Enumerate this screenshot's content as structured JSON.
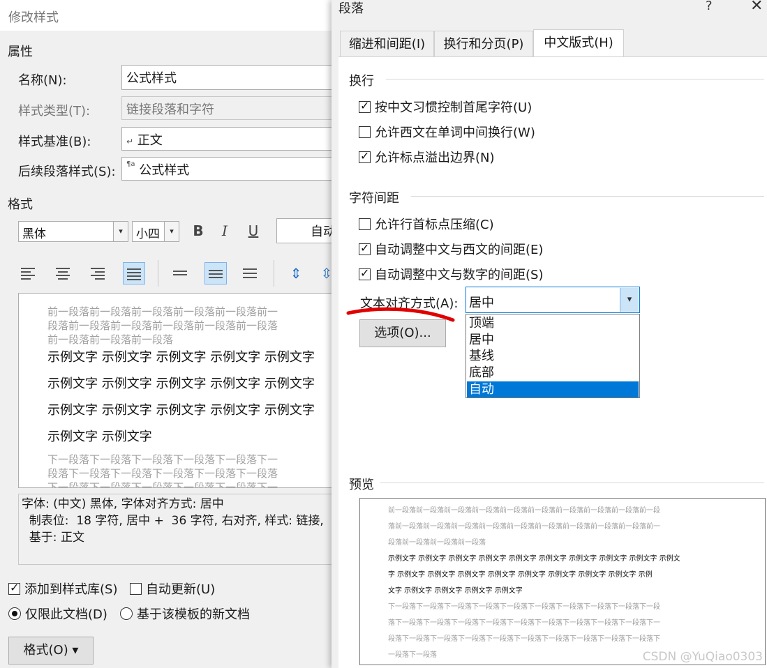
{
  "left_dialog": {
    "title": "修改样式",
    "properties_header": "属性",
    "name_label": "名称(N):",
    "name_value": "公式样式",
    "style_type_label": "样式类型(T):",
    "style_type_value": "链接段落和字符",
    "style_based_label": "样式基准(B):",
    "style_based_value": "正文",
    "next_para_label": "后续段落样式(S):",
    "next_para_value": "公式样式",
    "format_header": "格式",
    "font_name": "黑体",
    "font_size": "小四",
    "bold": "B",
    "italic": "I",
    "underline": "U",
    "color_value": "自动",
    "preview_prev": "前一段落前一段落前一段落前一段落前一段落前一段落前一段落前一段落前一段落前一段落前一段落前一段落前一段落前一段落前一段落",
    "preview_prev_1": "前一段落前一段落前一段落前一段落前一段落前一",
    "preview_prev_2": "段落前一段落前一段落前一段落前一段落前一段落",
    "preview_prev_3": "前一段落前一段落前一段落",
    "sample_1": "示例文字  示例文字  示例文字  示例文字  示例文字",
    "sample_2": "示例文字  示例文字  示例文字  示例文字  示例文字",
    "sample_3": "示例文字  示例文字  示例文字  示例文字  示例文字",
    "sample_4": "示例文字  示例文字",
    "preview_next_1": "下一段落下一段落下一段落下一段落下一段落下一",
    "preview_next_2": "段落下一段落下一段落下一段落下一段落下一段落",
    "preview_next_3": "下一段落下一段落下一段落下一段落下一段落下一",
    "desc_1": "字体: (中文) 黑体, 字体对齐方式: 居中",
    "desc_2": "  制表位:  18 字符, 居中 +  36 字符, 右对齐, 样式: 链接,",
    "desc_3": "  基于: 正文",
    "add_to_gallery": "添加到样式库(S)",
    "auto_update": "自动更新(U)",
    "only_this_doc": "仅限此文档(D)",
    "new_doc_template": "基于该模板的新文档",
    "format_button": "格式(O) ▾"
  },
  "right_dialog": {
    "title": "段落",
    "help": "?",
    "close": "✕",
    "tabs": [
      {
        "label": "缩进和间距(I)"
      },
      {
        "label": "换行和分页(P)"
      },
      {
        "label": "中文版式(H)"
      }
    ],
    "line_break_header": "换行",
    "opt_punct_control": "按中文习惯控制首尾字符(U)",
    "opt_western_wrap": "允许西文在单词中间换行(W)",
    "opt_punct_overflow": "允许标点溢出边界(N)",
    "char_spacing_header": "字符间距",
    "opt_compress_punct": "允许行首标点压缩(C)",
    "opt_auto_cjk_latin": "自动调整中文与西文的间距(E)",
    "opt_auto_cjk_digit": "自动调整中文与数字的间距(S)",
    "text_align_label": "文本对齐方式(A):",
    "text_align_value": "居中",
    "align_options": [
      "顶端",
      "居中",
      "基线",
      "底部",
      "自动"
    ],
    "options_button": "选项(O)...",
    "preview_header": "预览",
    "preview_lines": [
      "前一段落前一段落前一段落前一段落前一段落前一段落前一段落前一段落前一段落前一段",
      "落前一段落前一段落前一段落前一段落前一段落前一段落前一段落前一段落前一段落前一",
      "段落前一段落前一段落前一段落",
      "示例文字  示例文字  示例文字  示例文字  示例文字  示例文字  示例文字  示例文字  示例文字  示例文",
      "字  示例文字  示例文字  示例文字  示例文字  示例文字  示例文字  示例文字  示例文字  示例",
      "文字  示例文字  示例文字  示例文字  示例文字",
      "下一段落下一段落下一段落下一段落下一段落下一段落下一段落下一段落下一段落下一段",
      "落下一段落下一段落下一段落下一段落下一段落下一段落下一段落下一段落下一段落下一",
      "段落下一段落下一段落下一段落下一段落下一段落下一段落下一段落下一段落下一段落下",
      "一段落下一段落"
    ]
  },
  "watermark": "CSDN @YuQiao0303",
  "colors": {
    "accent": "#0078d7",
    "annotation": "#e00000"
  }
}
